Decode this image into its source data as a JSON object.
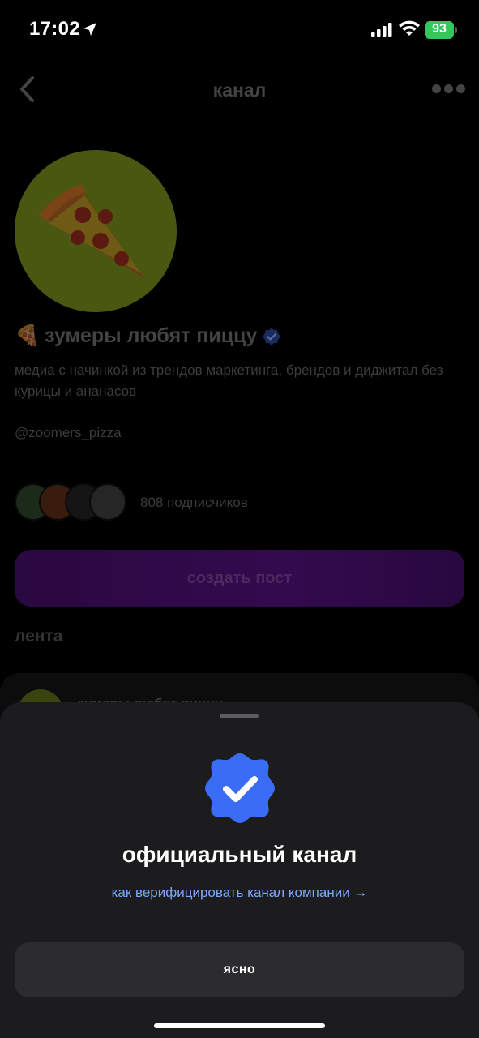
{
  "status_bar": {
    "time": "17:02",
    "battery_percent": "93"
  },
  "header": {
    "title": "канал"
  },
  "channel": {
    "emoji": "🍕",
    "name": "зумеры любят пиццу",
    "description": "медиа с начинкой из трендов маркетинга, брендов и диджитал без курицы и ананасов",
    "handle": "@zoomers_pizza",
    "subscribers": "808 подписчиков"
  },
  "actions": {
    "create_post": "создать пост"
  },
  "feed": {
    "title": "лента",
    "first_item_name": "зумеры любят пиццу"
  },
  "sheet": {
    "title": "официальный канал",
    "link": "как верифицировать канал компании →",
    "ok_button": "ясно"
  },
  "colors": {
    "accent_blue": "#3b6cf6",
    "link_blue": "#7aa6ff",
    "battery_green": "#34c759",
    "sheet_bg": "#1c1c1e"
  }
}
